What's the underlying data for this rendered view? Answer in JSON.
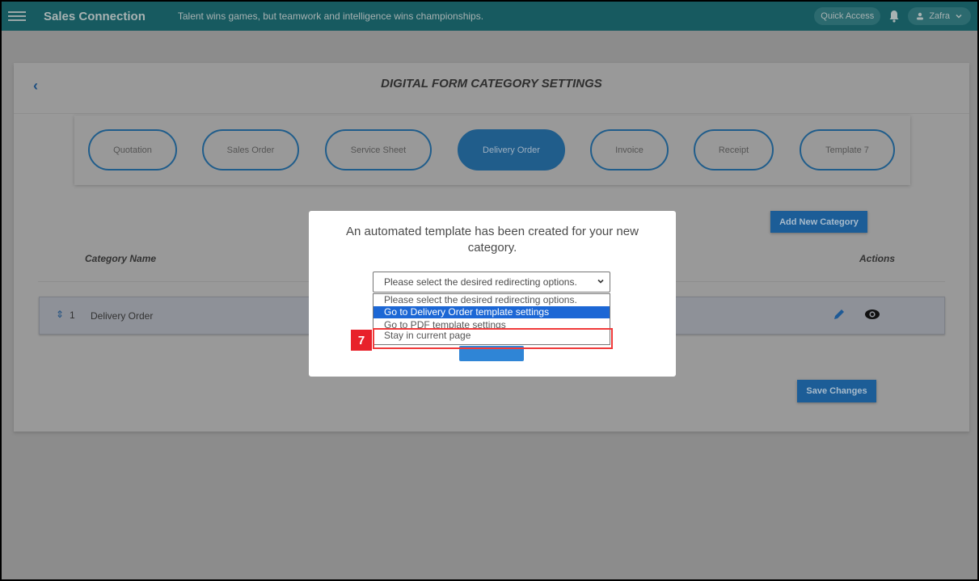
{
  "topbar": {
    "app_title": "Sales Connection",
    "tagline": "Talent wins games, but teamwork and intelligence wins championships.",
    "quick_access": "Quick Access",
    "user_name": "Zafra",
    "icons": [
      "menu-icon",
      "bell-icon",
      "user-icon",
      "chevron-down-icon"
    ]
  },
  "page": {
    "back_icon": "chevron-left-icon",
    "title": "DIGITAL FORM CATEGORY SETTINGS"
  },
  "tabs": [
    {
      "label": "Quotation",
      "active": false
    },
    {
      "label": "Sales Order",
      "active": false
    },
    {
      "label": "Service Sheet",
      "active": false
    },
    {
      "label": "Delivery Order",
      "active": true
    },
    {
      "label": "Invoice",
      "active": false
    },
    {
      "label": "Receipt",
      "active": false
    },
    {
      "label": "Template 7",
      "active": false
    }
  ],
  "actions": {
    "add_new_category": "Add New Category",
    "save_changes": "Save Changes"
  },
  "table": {
    "headers": {
      "category_name": "Category Name",
      "actions": "Actions"
    },
    "rows": [
      {
        "index": "1",
        "name": "Delivery Order",
        "icons": [
          "sort-icon",
          "edit-icon",
          "view-icon"
        ]
      }
    ]
  },
  "modal": {
    "message": "An automated template has been created for your new category.",
    "select_value": "Please select the desired redirecting options.",
    "options": [
      "Please select the desired redirecting options.",
      "Go to Delivery Order template settings",
      "Go to PDF template settings",
      "Stay in current page"
    ],
    "highlighted_option_index": 1
  },
  "annotation": {
    "step_number": "7",
    "highlight_color": "#f03a3a"
  },
  "colors": {
    "topbar": "#175a60",
    "primary": "#1c5d97",
    "select_highlight": "#1c67d5"
  }
}
